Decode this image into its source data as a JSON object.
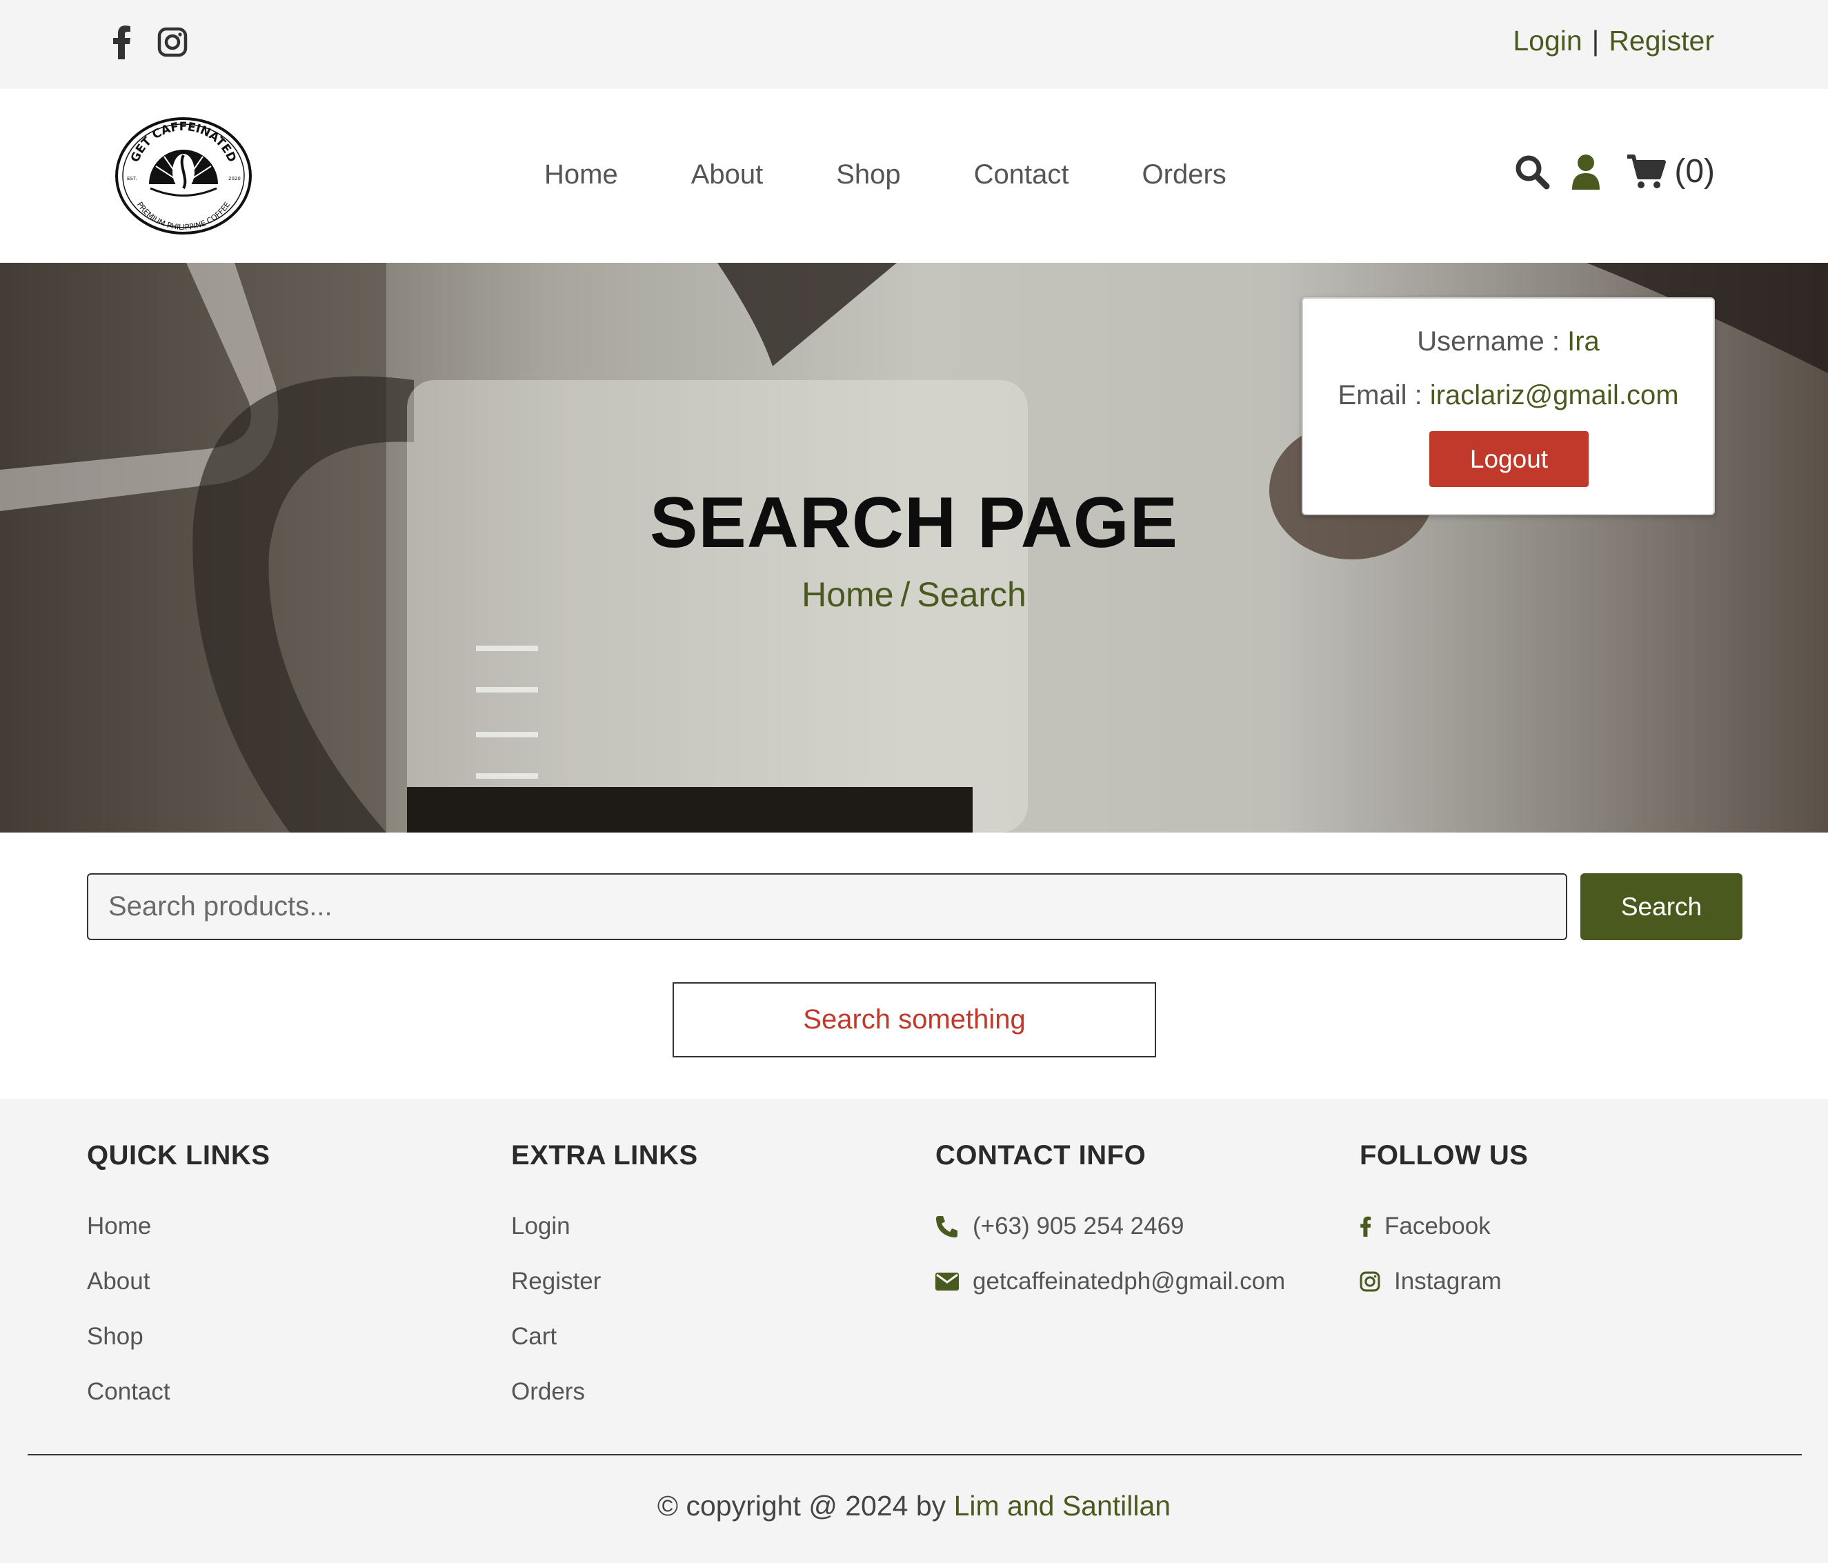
{
  "topbar": {
    "social_icons": [
      "facebook-icon",
      "instagram-icon"
    ],
    "login_label": "Login",
    "separator": "|",
    "register_label": "Register"
  },
  "header": {
    "logo_text_top": "GET CAFFEINATED",
    "logo_text_bottom": "PREMIUM PHILIPPINE COFFEE",
    "logo_est": "EST.",
    "logo_year": "2020",
    "nav": [
      "Home",
      "About",
      "Shop",
      "Contact",
      "Orders"
    ],
    "icons": [
      "search-icon",
      "user-icon",
      "cart-icon"
    ],
    "cart_count": "(0)"
  },
  "hero": {
    "title": "SEARCH PAGE",
    "breadcrumb_home": "Home",
    "breadcrumb_sep": "/",
    "breadcrumb_current": "Search"
  },
  "user_box": {
    "username_label": "Username : ",
    "username": "Ira",
    "email_label": "Email : ",
    "email": "iraclariz@gmail.com",
    "logout_label": "Logout"
  },
  "search": {
    "placeholder": "Search products...",
    "value": "",
    "button_label": "Search",
    "empty_message": "Search something"
  },
  "footer": {
    "quick_links": {
      "title": "QUICK LINKS",
      "items": [
        "Home",
        "About",
        "Shop",
        "Contact"
      ]
    },
    "extra_links": {
      "title": "EXTRA LINKS",
      "items": [
        "Login",
        "Register",
        "Cart",
        "Orders"
      ]
    },
    "contact_info": {
      "title": "CONTACT INFO",
      "phone": "(+63) 905 254 2469",
      "email": "getcaffeinatedph@gmail.com"
    },
    "follow_us": {
      "title": "FOLLOW US",
      "facebook": "Facebook",
      "instagram": "Instagram"
    },
    "copyright_prefix": "© copyright @ 2024 by ",
    "copyright_authors": "Lim and Santillan"
  },
  "colors": {
    "accent_green": "#4a5a1f",
    "logout_red": "#c0392b",
    "footer_bg": "#f4f4f4"
  }
}
